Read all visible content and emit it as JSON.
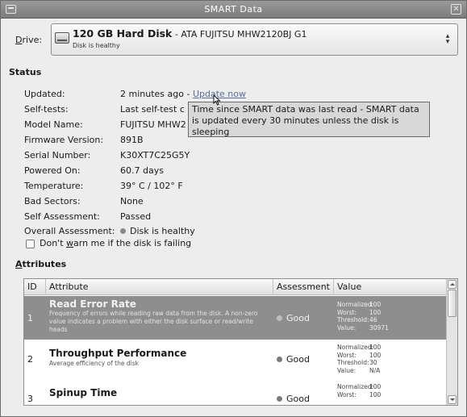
{
  "window": {
    "title": "SMART Data"
  },
  "drive": {
    "label_prefix": "",
    "label_mnemonic": "D",
    "label_rest": "rive:",
    "name_bold": "120 GB Hard Disk",
    "name_rest": " - ATA FUJITSU MHW2120BJ G1",
    "subtitle": "Disk is healthy"
  },
  "status": {
    "title": "Status",
    "rows": [
      {
        "label": "Updated:",
        "value": "2 minutes ago",
        "sep": " - ",
        "link": "Update now"
      },
      {
        "label": "Self-tests:",
        "value": "Last self-test c"
      },
      {
        "label": "Model Name:",
        "value": "FUJITSU MHW2"
      },
      {
        "label": "Firmware Version:",
        "value": "891B"
      },
      {
        "label": "Serial Number:",
        "value": "K30XT7C25G5Y"
      },
      {
        "label": "Powered On:",
        "value": "60.7 days"
      },
      {
        "label": "Temperature:",
        "value": "39° C / 102° F"
      },
      {
        "label": "Bad Sectors:",
        "value": "None"
      },
      {
        "label": "Self Assessment:",
        "value": "Passed"
      },
      {
        "label": "Overall Assessment:",
        "value": "Disk is healthy"
      }
    ],
    "tooltip": "Time since SMART data was last read - SMART data is updated every 30 minutes unless the disk is sleeping",
    "warn_checkbox": {
      "pre": "Don't ",
      "mnemonic": "w",
      "post": "arn me if the disk is failing",
      "checked": false
    }
  },
  "attributes": {
    "title_mnemonic": "A",
    "title_rest": "ttributes",
    "columns": [
      "ID",
      "Attribute",
      "Assessment",
      "Value"
    ],
    "rows": [
      {
        "id": "1",
        "name": "Read Error Rate",
        "desc": "Frequency of errors while reading raw data from the disk. A non-zero value indicates a problem with either the disk surface or read/write heads",
        "assessment": "Good",
        "normalized": "100",
        "worst": "100",
        "threshold": "46",
        "value": "30971",
        "selected": true
      },
      {
        "id": "2",
        "name": "Throughput Performance",
        "desc": "Average efficiency of the disk",
        "assessment": "Good",
        "normalized": "100",
        "worst": "100",
        "threshold": "30",
        "value": "N/A",
        "selected": false
      },
      {
        "id": "3",
        "name": "Spinup Time",
        "desc": "",
        "assessment": "Good",
        "normalized": "100",
        "worst": "100",
        "threshold": "",
        "value": "",
        "selected": false
      }
    ],
    "value_keys": {
      "normalized": "Normalized:",
      "worst": "Worst:",
      "threshold": "Threshold:",
      "value": "Value:"
    }
  },
  "colors": {
    "selected_row": "#8e8e8e",
    "titlebar": "#8a8a8a",
    "link": "#5a6f9a"
  }
}
